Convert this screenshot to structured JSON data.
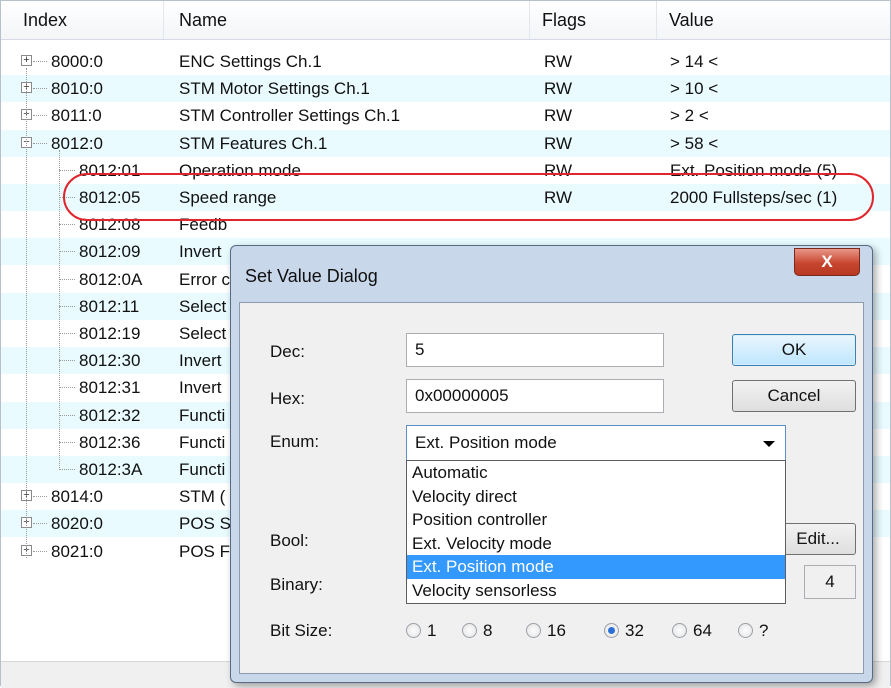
{
  "table": {
    "columns": [
      "Index",
      "Name",
      "Flags",
      "Value"
    ],
    "rows": [
      {
        "index": "8000:0",
        "name": "ENC Settings Ch.1",
        "flags": "RW",
        "value": "> 14 <",
        "expander": "+"
      },
      {
        "index": "8010:0",
        "name": "STM Motor Settings Ch.1",
        "flags": "RW",
        "value": "> 10 <",
        "expander": "+"
      },
      {
        "index": "8011:0",
        "name": "STM Controller Settings Ch.1",
        "flags": "RW",
        "value": "> 2 <",
        "expander": "+"
      },
      {
        "index": "8012:0",
        "name": "STM Features Ch.1",
        "flags": "RW",
        "value": "> 58 <",
        "expander": "−"
      },
      {
        "index": "8012:01",
        "name": "Operation mode",
        "flags": "RW",
        "value": "Ext. Position mode (5)"
      },
      {
        "index": "8012:05",
        "name": "Speed range",
        "flags": "RW",
        "value": "2000 Fullsteps/sec (1)"
      },
      {
        "index": "8012:08",
        "name": "Feedb",
        "flags": "",
        "value": ""
      },
      {
        "index": "8012:09",
        "name": "Invert",
        "flags": "",
        "value": ""
      },
      {
        "index": "8012:0A",
        "name": "Error c",
        "flags": "",
        "value": ""
      },
      {
        "index": "8012:11",
        "name": "Select",
        "flags": "",
        "value": ""
      },
      {
        "index": "8012:19",
        "name": "Select",
        "flags": "",
        "value": ""
      },
      {
        "index": "8012:30",
        "name": "Invert",
        "flags": "",
        "value": ""
      },
      {
        "index": "8012:31",
        "name": "Invert",
        "flags": "",
        "value": ""
      },
      {
        "index": "8012:32",
        "name": "Functi",
        "flags": "",
        "value": ""
      },
      {
        "index": "8012:36",
        "name": "Functi",
        "flags": "",
        "value": ""
      },
      {
        "index": "8012:3A",
        "name": "Functi",
        "flags": "",
        "value": ""
      },
      {
        "index": "8014:0",
        "name": "STM (",
        "flags": "",
        "value": "",
        "expander": "+"
      },
      {
        "index": "8020:0",
        "name": "POS S",
        "flags": "",
        "value": "",
        "expander": "+"
      },
      {
        "index": "8021:0",
        "name": "POS F",
        "flags": "",
        "value": "",
        "expander": "+"
      }
    ]
  },
  "dialog": {
    "title": "Set Value Dialog",
    "close_label": "X",
    "dec_label": "Dec:",
    "dec_value": "5",
    "hex_label": "Hex:",
    "hex_value": "0x00000005",
    "enum_label": "Enum:",
    "enum_value": "Ext. Position mode",
    "enum_options": [
      "Automatic",
      "Velocity direct",
      "Position controller",
      "Ext. Velocity mode",
      "Ext. Position mode",
      "Velocity sensorless"
    ],
    "enum_selected_index": 4,
    "bool_label": "Bool:",
    "binary_label": "Binary:",
    "binary_size": "4",
    "bitsize_label": "Bit Size:",
    "bitsize_options": [
      "1",
      "8",
      "16",
      "32",
      "64",
      "?"
    ],
    "bitsize_selected": "32",
    "ok_label": "OK",
    "cancel_label": "Cancel",
    "edit_label": "Edit..."
  },
  "colors": {
    "alt_row": "#e9fbff",
    "highlight_oval": "#e0252b",
    "dialog_frame": "#c9d7ea",
    "selection": "#3399ff"
  }
}
